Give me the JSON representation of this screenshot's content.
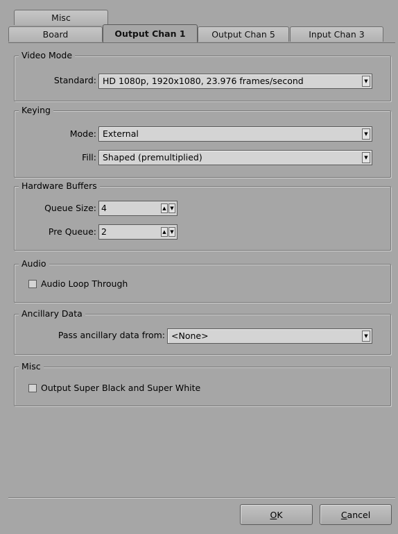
{
  "tabs": {
    "back_row": [
      "Misc"
    ],
    "front_row": [
      "Board",
      "Output Chan 1",
      "Output Chan 5",
      "Input Chan 3"
    ],
    "active": "Output Chan 1"
  },
  "video_mode": {
    "title": "Video Mode",
    "standard_label": "Standard:",
    "standard_value": "HD 1080p, 1920x1080, 23.976 frames/second"
  },
  "keying": {
    "title": "Keying",
    "mode_label": "Mode:",
    "mode_value": "External",
    "fill_label": "Fill:",
    "fill_value": "Shaped (premultiplied)"
  },
  "hardware_buffers": {
    "title": "Hardware Buffers",
    "queue_size_label": "Queue Size:",
    "queue_size_value": "4",
    "pre_queue_label": "Pre Queue:",
    "pre_queue_value": "2"
  },
  "audio": {
    "title": "Audio",
    "loop_through_label": "Audio Loop Through",
    "loop_through_checked": false
  },
  "ancillary": {
    "title": "Ancillary Data",
    "pass_label": "Pass ancillary data from:",
    "pass_value": "<None>"
  },
  "misc": {
    "title": "Misc",
    "super_label": "Output Super Black and Super White",
    "super_checked": false
  },
  "buttons": {
    "ok_accel": "O",
    "ok_rest": "K",
    "cancel_accel": "C",
    "cancel_rest": "ancel"
  },
  "icons": {
    "dropdown": "chevron-down-icon",
    "spin_up": "arrow-up-icon",
    "spin_down": "arrow-down-icon"
  }
}
